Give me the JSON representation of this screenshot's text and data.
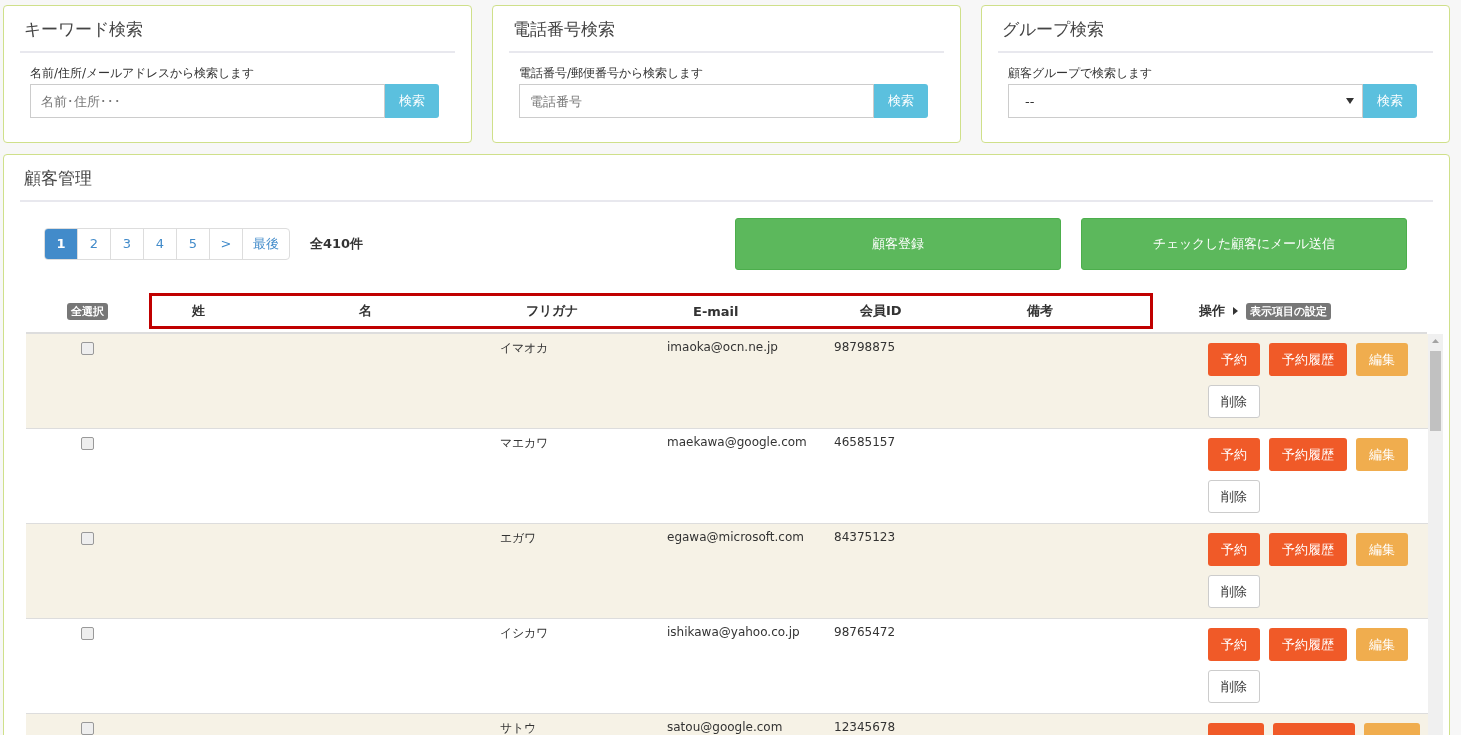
{
  "search_panels": [
    {
      "kind": "text",
      "title": "キーワード検索",
      "hint": "名前/住所/メールアドレスから検索します",
      "placeholder": "名前･住所･･･",
      "button": "検索"
    },
    {
      "kind": "text",
      "title": "電話番号検索",
      "hint": "電話番号/郵便番号から検索します",
      "placeholder": "電話番号",
      "button": "検索"
    },
    {
      "kind": "select",
      "title": "グループ検索",
      "hint": "顧客グループで検索します",
      "value": "--",
      "button": "検索"
    }
  ],
  "customers": {
    "title": "顧客管理",
    "pages": [
      {
        "label": "1",
        "selected": true
      },
      {
        "label": "2",
        "selected": false
      },
      {
        "label": "3",
        "selected": false
      },
      {
        "label": "4",
        "selected": false
      },
      {
        "label": "5",
        "selected": false
      },
      {
        "label": ">",
        "selected": false
      },
      {
        "label": "最後",
        "selected": false
      }
    ],
    "total": "全410件",
    "actions": [
      "顧客登録",
      "チェックした顧客にメール送信"
    ],
    "select_all": "全選択",
    "columns": [
      "姓",
      "名",
      "フリガナ",
      "E-mail",
      "会員ID",
      "備考"
    ],
    "operations_header": "操作",
    "display_settings": "表示項目の設定",
    "rows": [
      {
        "checked": false,
        "furigana": "イマオカ",
        "email": "imaoka@ocn.ne.jp",
        "member_id": "98798875",
        "buttons": [
          {
            "kind": "reserve",
            "label": "予約"
          },
          {
            "kind": "reserve",
            "label": "予約履歴"
          },
          {
            "kind": "edit",
            "label": "編集"
          },
          {
            "kind": "delete",
            "label": "削除"
          }
        ]
      },
      {
        "checked": false,
        "furigana": "マエカワ",
        "email": "maekawa@google.com",
        "member_id": "46585157",
        "buttons": [
          {
            "kind": "reserve",
            "label": "予約"
          },
          {
            "kind": "reserve",
            "label": "予約履歴"
          },
          {
            "kind": "edit",
            "label": "編集"
          },
          {
            "kind": "delete",
            "label": "削除"
          }
        ]
      },
      {
        "checked": false,
        "furigana": "エガワ",
        "email": "egawa@microsoft.com",
        "member_id": "84375123",
        "buttons": [
          {
            "kind": "reserve",
            "label": "予約"
          },
          {
            "kind": "reserve",
            "label": "予約履歴"
          },
          {
            "kind": "edit",
            "label": "編集"
          },
          {
            "kind": "delete",
            "label": "削除"
          }
        ]
      },
      {
        "checked": false,
        "furigana": "イシカワ",
        "email": "ishikawa@yahoo.co.jp",
        "member_id": "98765472",
        "buttons": [
          {
            "kind": "reserve",
            "label": "予約"
          },
          {
            "kind": "reserve",
            "label": "予約履歴"
          },
          {
            "kind": "edit",
            "label": "編集"
          },
          {
            "kind": "delete",
            "label": "削除"
          }
        ]
      },
      {
        "checked": false,
        "furigana": "サトウ",
        "email": "satou@google.com",
        "member_id": "12345678",
        "buttons": [
          {
            "kind": "reserve"
          },
          {
            "kind": "reserve"
          },
          {
            "kind": "edit"
          }
        ]
      }
    ]
  }
}
